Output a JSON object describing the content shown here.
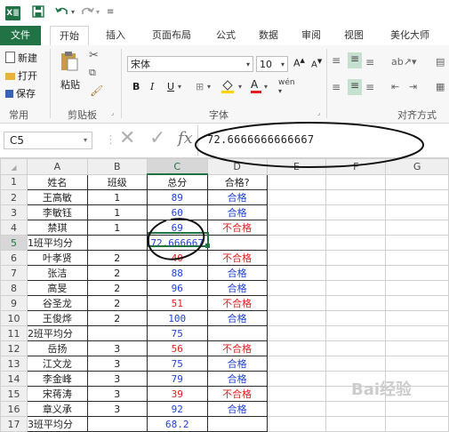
{
  "window": {
    "app_icon": "X≣",
    "qat": [
      "save-icon",
      "undo-icon",
      "redo-icon",
      "customize-icon"
    ]
  },
  "tabs": [
    "文件",
    "开始",
    "插入",
    "页面布局",
    "公式",
    "数据",
    "审阅",
    "视图",
    "美化大师"
  ],
  "ribbon": {
    "clipboard": {
      "new": "新建",
      "open": "打开",
      "save": "保存",
      "paste": "粘贴",
      "group_common": "常用",
      "group_clipboard": "剪贴板"
    },
    "font": {
      "name": "宋体",
      "size": "10",
      "bold": "B",
      "italic": "I",
      "underline": "U",
      "wen": "wén",
      "group": "字体"
    },
    "align": {
      "group": "对齐方式"
    }
  },
  "formula_bar": {
    "namebox": "C5",
    "fx": "fx",
    "value": "72.6666666666667"
  },
  "columns": [
    "A",
    "B",
    "C",
    "D",
    "E",
    "F",
    "G"
  ],
  "rows": [
    {
      "n": "1",
      "a": "姓名",
      "b": "班级",
      "c": "总分",
      "d": "合格?",
      "cc": "",
      "dc": ""
    },
    {
      "n": "2",
      "a": "王高敏",
      "b": "1",
      "c": "89",
      "d": "合格",
      "cc": "blue",
      "dc": "blue"
    },
    {
      "n": "3",
      "a": "李敏钰",
      "b": "1",
      "c": "60",
      "d": "合格",
      "cc": "blue",
      "dc": "blue"
    },
    {
      "n": "4",
      "a": "禁琪",
      "b": "1",
      "c": "69",
      "d": "不合格",
      "cc": "blue",
      "dc": "red"
    },
    {
      "n": "5",
      "a": "1班平均分",
      "b": "",
      "c": "72.666667",
      "d": "",
      "cc": "blue",
      "dc": ""
    },
    {
      "n": "6",
      "a": "叶孝贤",
      "b": "2",
      "c": "40",
      "d": "不合格",
      "cc": "red",
      "dc": "red"
    },
    {
      "n": "7",
      "a": "张洁",
      "b": "2",
      "c": "88",
      "d": "合格",
      "cc": "blue",
      "dc": "blue"
    },
    {
      "n": "8",
      "a": "高旻",
      "b": "2",
      "c": "96",
      "d": "合格",
      "cc": "blue",
      "dc": "blue"
    },
    {
      "n": "9",
      "a": "谷圣龙",
      "b": "2",
      "c": "51",
      "d": "不合格",
      "cc": "red",
      "dc": "red"
    },
    {
      "n": "10",
      "a": "王俊烨",
      "b": "2",
      "c": "100",
      "d": "合格",
      "cc": "blue",
      "dc": "blue"
    },
    {
      "n": "11",
      "a": "2班平均分",
      "b": "",
      "c": "75",
      "d": "",
      "cc": "blue",
      "dc": ""
    },
    {
      "n": "12",
      "a": "岳扬",
      "b": "3",
      "c": "56",
      "d": "不合格",
      "cc": "red",
      "dc": "red"
    },
    {
      "n": "13",
      "a": "江文龙",
      "b": "3",
      "c": "75",
      "d": "合格",
      "cc": "blue",
      "dc": "blue"
    },
    {
      "n": "14",
      "a": "李金峰",
      "b": "3",
      "c": "79",
      "d": "合格",
      "cc": "blue",
      "dc": "blue"
    },
    {
      "n": "15",
      "a": "宋蒋涛",
      "b": "3",
      "c": "39",
      "d": "不合格",
      "cc": "red",
      "dc": "red"
    },
    {
      "n": "16",
      "a": "章义承",
      "b": "3",
      "c": "92",
      "d": "合格",
      "cc": "blue",
      "dc": "blue"
    },
    {
      "n": "17",
      "a": "3班平均分",
      "b": "",
      "c": "68.2",
      "d": "",
      "cc": "blue",
      "dc": ""
    }
  ],
  "selection": {
    "cell": "C5",
    "row": "5",
    "column": "C"
  },
  "colors": {
    "excel_green": "#217346",
    "pass_blue": "#1f3fd6",
    "fail_red": "#e21d1d"
  },
  "watermark": "Bai经验"
}
